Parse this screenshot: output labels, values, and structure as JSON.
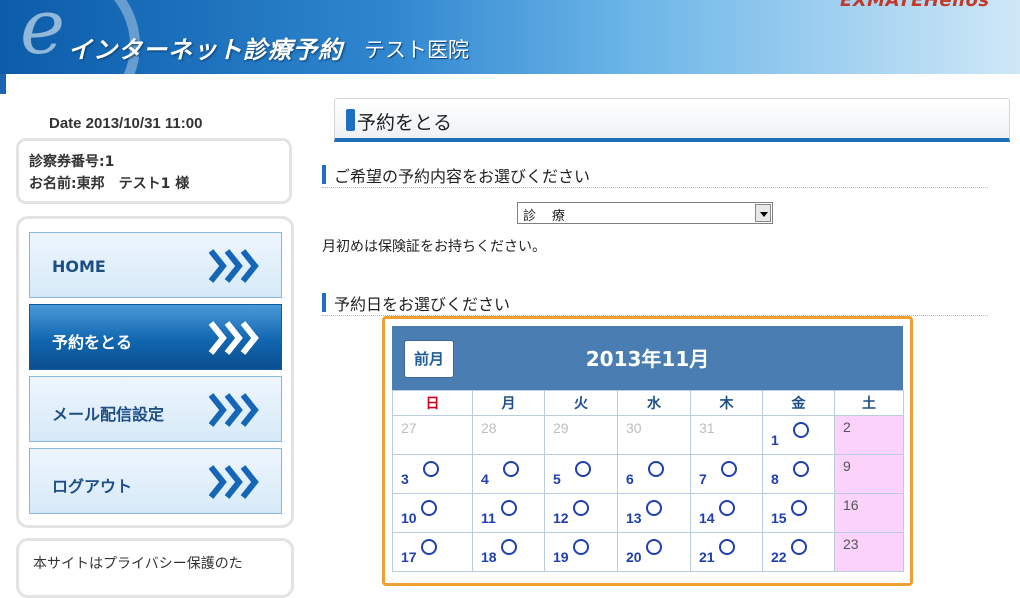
{
  "header": {
    "logo_letter": "e",
    "title": "インターネット診療予約",
    "clinic_name": "テスト医院",
    "brand": "EXMATEHelios"
  },
  "sidebar": {
    "date": "Date 2013/10/31 11:00",
    "patient_number": "診察券番号:1",
    "patient_name": "お名前:東邦　テスト1 様",
    "nav": [
      {
        "label": "HOME",
        "active": false
      },
      {
        "label": "予約をとる",
        "active": true
      },
      {
        "label": "メール配信設定",
        "active": false
      },
      {
        "label": "ログアウト",
        "active": false
      }
    ],
    "privacy_text": "本サイトはプライバシー保護のた"
  },
  "main": {
    "page_title": "予約をとる",
    "section1": "ご希望の予約内容をお選びください",
    "select_value": "診 療",
    "note": "月初めは保険証をお持ちください。",
    "section2": "予約日をお選びください"
  },
  "calendar": {
    "prev_label": "前月",
    "title": "2013年11月",
    "weekdays": [
      "日",
      "月",
      "火",
      "水",
      "木",
      "金",
      "土"
    ],
    "weeks": [
      [
        {
          "d": "27",
          "t": "past"
        },
        {
          "d": "28",
          "t": "past"
        },
        {
          "d": "29",
          "t": "past"
        },
        {
          "d": "30",
          "t": "past"
        },
        {
          "d": "31",
          "t": "past"
        },
        {
          "d": "1",
          "t": "avail"
        },
        {
          "d": "2",
          "t": "sat"
        }
      ],
      [
        {
          "d": "3",
          "t": "avail"
        },
        {
          "d": "4",
          "t": "avail"
        },
        {
          "d": "5",
          "t": "avail"
        },
        {
          "d": "6",
          "t": "avail"
        },
        {
          "d": "7",
          "t": "avail"
        },
        {
          "d": "8",
          "t": "avail"
        },
        {
          "d": "9",
          "t": "sat"
        }
      ],
      [
        {
          "d": "10",
          "t": "avail"
        },
        {
          "d": "11",
          "t": "avail"
        },
        {
          "d": "12",
          "t": "avail"
        },
        {
          "d": "13",
          "t": "avail"
        },
        {
          "d": "14",
          "t": "avail"
        },
        {
          "d": "15",
          "t": "avail"
        },
        {
          "d": "16",
          "t": "sat"
        }
      ],
      [
        {
          "d": "17",
          "t": "avail"
        },
        {
          "d": "18",
          "t": "avail"
        },
        {
          "d": "19",
          "t": "avail"
        },
        {
          "d": "20",
          "t": "avail"
        },
        {
          "d": "21",
          "t": "avail"
        },
        {
          "d": "22",
          "t": "avail"
        },
        {
          "d": "23",
          "t": "sat"
        }
      ]
    ]
  }
}
